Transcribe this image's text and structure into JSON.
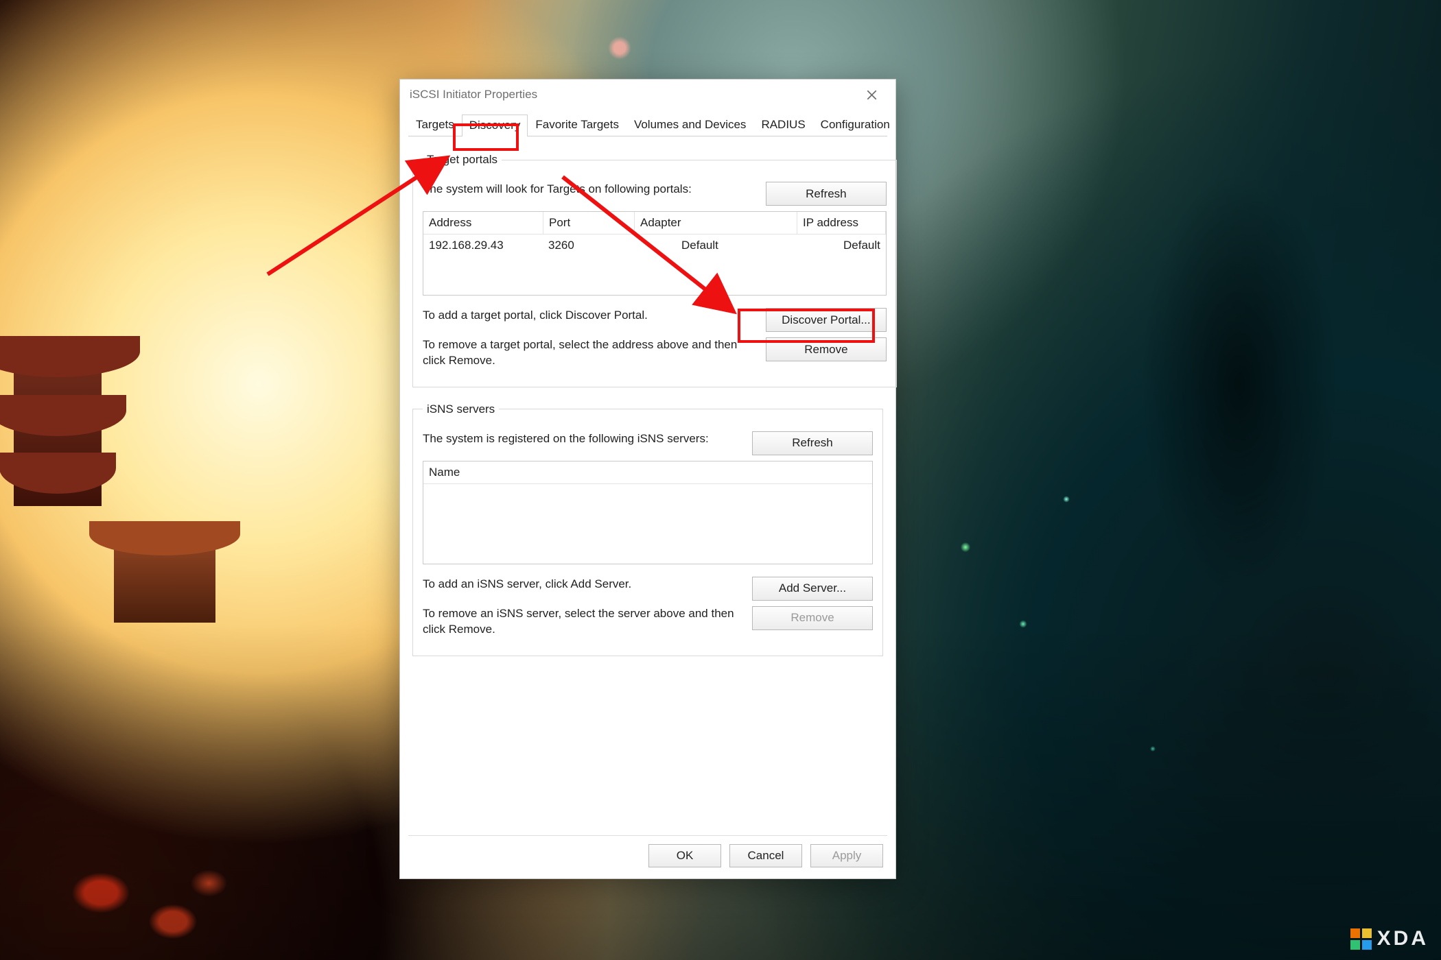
{
  "window": {
    "title": "iSCSI Initiator Properties"
  },
  "tabs": {
    "items": [
      {
        "label": "Targets"
      },
      {
        "label": "Discovery"
      },
      {
        "label": "Favorite Targets"
      },
      {
        "label": "Volumes and Devices"
      },
      {
        "label": "RADIUS"
      },
      {
        "label": "Configuration"
      }
    ],
    "active_index": 1
  },
  "target_portals": {
    "legend": "Target portals",
    "hint": "The system will look for Targets on following portals:",
    "refresh_label": "Refresh",
    "columns": {
      "address": "Address",
      "port": "Port",
      "adapter": "Adapter",
      "ip": "IP address"
    },
    "rows": [
      {
        "address": "192.168.29.43",
        "port": "3260",
        "adapter": "Default",
        "ip": "Default"
      }
    ],
    "add_hint": "To add a target portal, click Discover Portal.",
    "discover_label": "Discover Portal...",
    "remove_hint": "To remove a target portal, select the address above and then click Remove.",
    "remove_label": "Remove"
  },
  "isns": {
    "legend": "iSNS servers",
    "hint": "The system is registered on the following iSNS servers:",
    "refresh_label": "Refresh",
    "name_header": "Name",
    "add_hint": "To add an iSNS server, click Add Server.",
    "add_label": "Add Server...",
    "remove_hint": "To remove an iSNS server, select the server above and then click Remove.",
    "remove_label": "Remove"
  },
  "dialog_buttons": {
    "ok": "OK",
    "cancel": "Cancel",
    "apply": "Apply"
  },
  "annotation": {
    "color": "#e11"
  },
  "watermark": {
    "text": "XDA",
    "colors": [
      "#ff7a00",
      "#ffcf33",
      "#34d07a",
      "#2aa8ff"
    ]
  }
}
